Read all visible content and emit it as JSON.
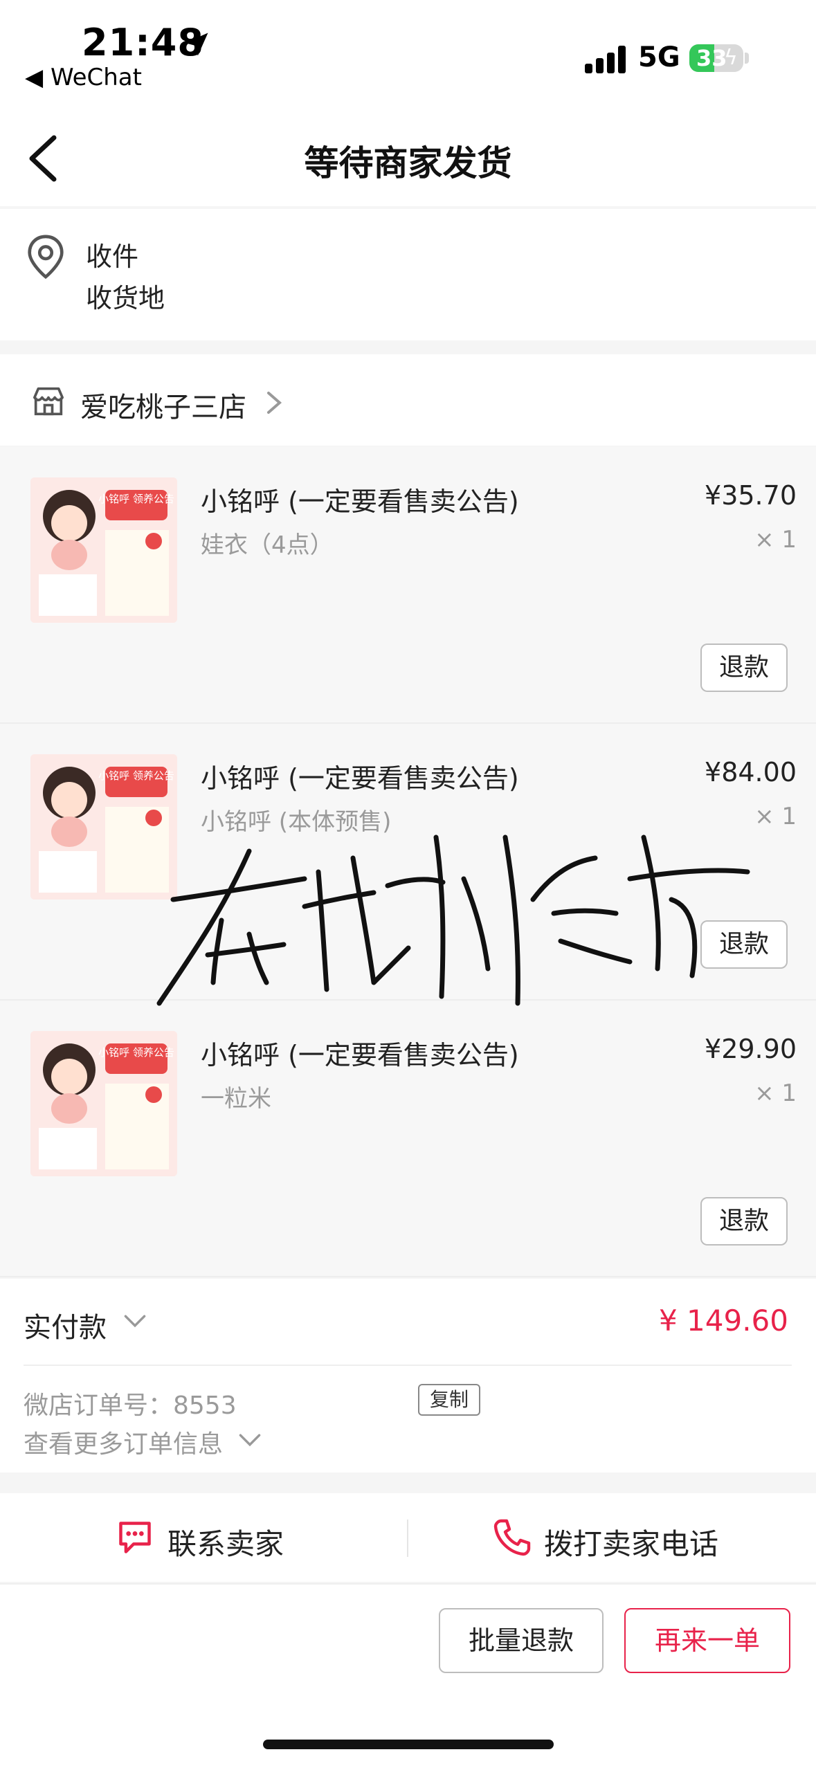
{
  "status_bar": {
    "time": "21:48",
    "back_app_label": "WeChat",
    "network": "5G",
    "battery": "33",
    "location_icon": "location-arrow-icon",
    "signal_icon": "cellular-signal-icon",
    "battery_icon": "battery-charging-icon"
  },
  "nav": {
    "title": "等待商家发货",
    "back_icon": "chevron-left-icon"
  },
  "address": {
    "icon": "map-pin-icon",
    "name_line": "收件",
    "address_line": "收货地"
  },
  "shop": {
    "icon": "store-icon",
    "name": "爱吃桃子三店",
    "chevron_icon": "chevron-right-icon"
  },
  "items": [
    {
      "title": "小铭呼 (一定要看售卖公告)",
      "sku": "娃衣（4点）",
      "price": "¥35.70",
      "qty": "× 1",
      "refund_label": "退款"
    },
    {
      "title": "小铭呼 (一定要看售卖公告)",
      "sku": "小铭呼 (本体预售)",
      "price": "¥84.00",
      "qty": "× 1",
      "refund_label": "退款"
    },
    {
      "title": "小铭呼 (一定要看售卖公告)",
      "sku": "一粒米",
      "price": "¥29.90",
      "qty": "× 1",
      "refund_label": "退款"
    }
  ],
  "thumbnail": {
    "header_text": "小铭呼 领养公告"
  },
  "payment": {
    "label": "实付款",
    "amount": "¥ 149.60",
    "order_no": "微店订单号：8553",
    "copy_label": "复制",
    "more_info": "查看更多订单信息"
  },
  "contact": {
    "chat_label": "联系卖家",
    "phone_label": "拨打卖家电话",
    "chat_icon": "chat-bubble-icon",
    "phone_icon": "phone-icon"
  },
  "actions": {
    "batch_refund": "批量退款",
    "reorder": "再来一单"
  },
  "signature": {
    "text": "在杭州念海"
  },
  "colors": {
    "accent": "#e8224a",
    "secondary_text": "#9a9a9a",
    "battery_green": "#34c759"
  }
}
